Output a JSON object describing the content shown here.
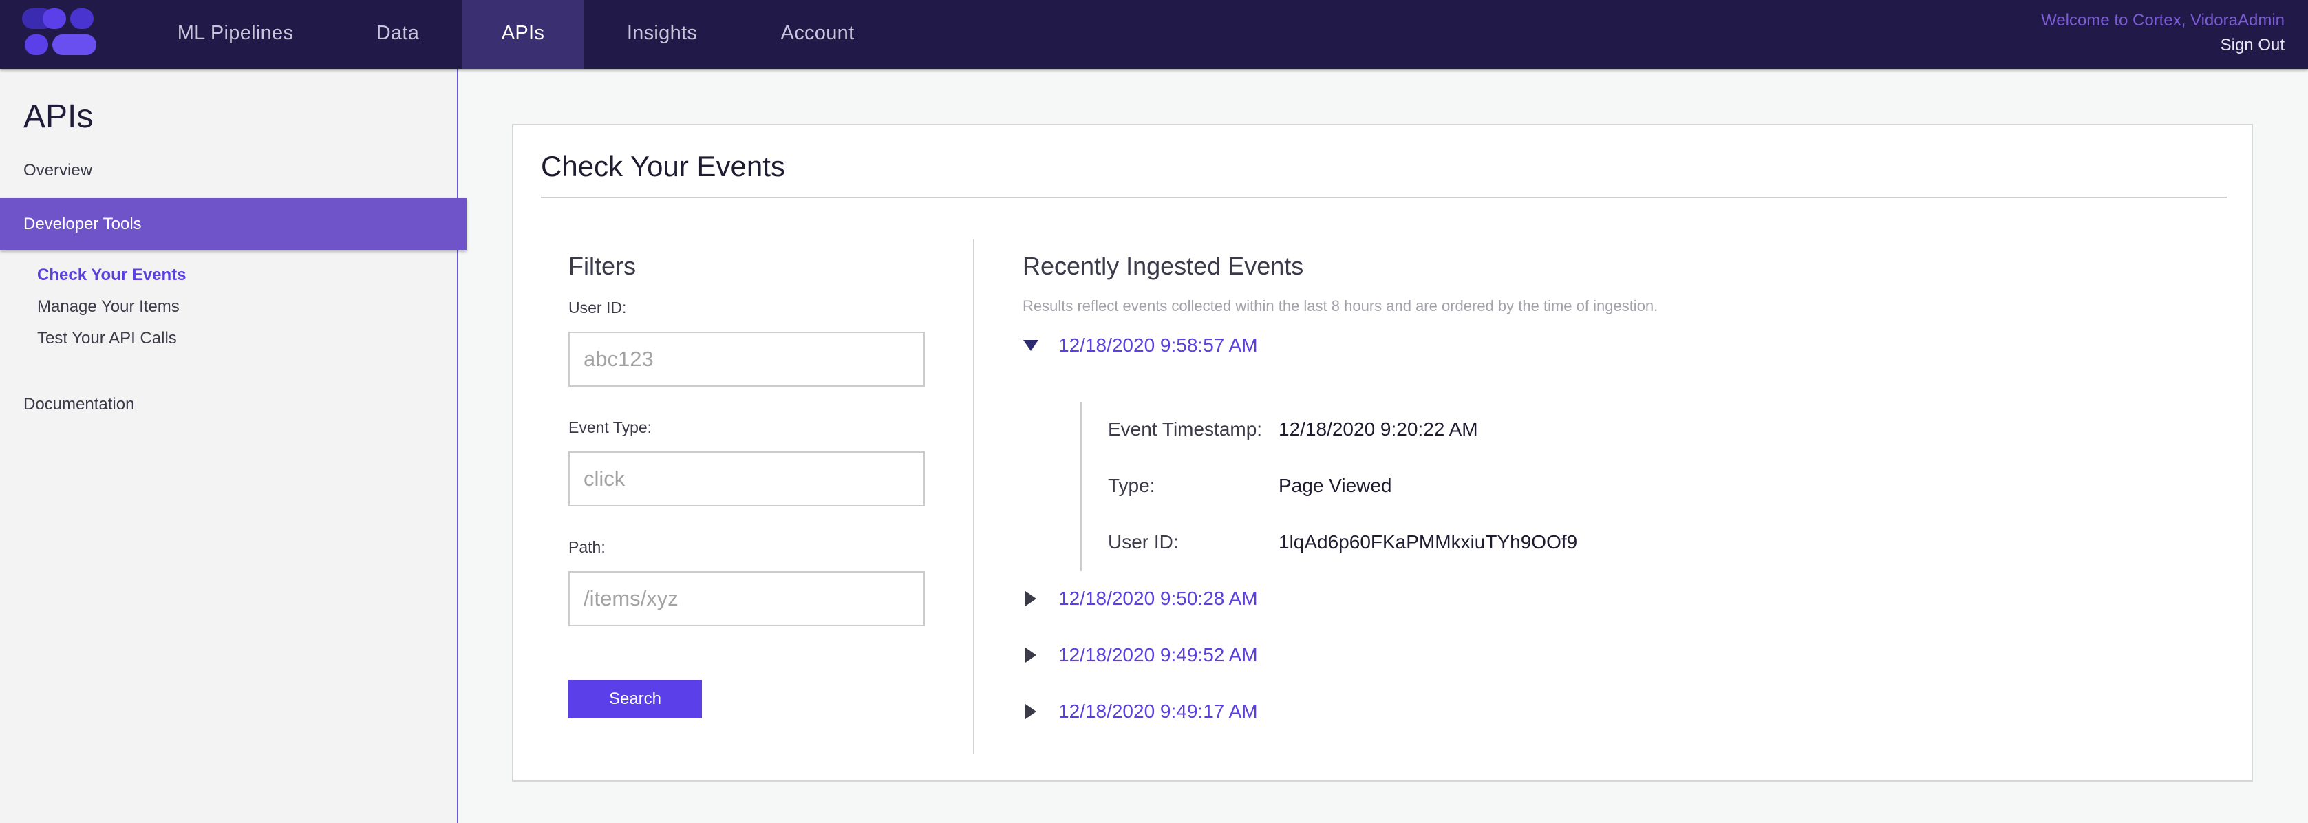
{
  "nav": {
    "logo_icon": "cortex-logo-icon",
    "items": [
      {
        "label": "ML Pipelines",
        "active": false
      },
      {
        "label": "Data",
        "active": false
      },
      {
        "label": "APIs",
        "active": true
      },
      {
        "label": "Insights",
        "active": false
      },
      {
        "label": "Account",
        "active": false
      }
    ],
    "welcome": "Welcome to Cortex, VidoraAdmin",
    "sign_out": "Sign Out"
  },
  "sidebar": {
    "title": "APIs",
    "overview": "Overview",
    "developer_tools": "Developer Tools",
    "sub_items": [
      {
        "label": "Check Your Events",
        "current": true
      },
      {
        "label": "Manage Your Items",
        "current": false
      },
      {
        "label": "Test Your API Calls",
        "current": false
      }
    ],
    "documentation": "Documentation"
  },
  "main": {
    "title": "Check Your Events",
    "filters": {
      "title": "Filters",
      "user_id_label": "User ID:",
      "user_id_placeholder": "abc123",
      "user_id_value": "",
      "event_type_label": "Event Type:",
      "event_type_placeholder": "click",
      "event_type_value": "",
      "path_label": "Path:",
      "path_placeholder": "/items/xyz",
      "path_value": "",
      "search_label": "Search"
    },
    "events": {
      "title": "Recently Ingested Events",
      "note": "Results reflect events collected within the last 8 hours and are ordered by the time of ingestion.",
      "list": [
        {
          "timestamp": "12/18/2020 9:58:57 AM",
          "expanded": true,
          "icon": "caret-down-icon"
        },
        {
          "timestamp": "12/18/2020 9:50:28 AM",
          "expanded": false,
          "icon": "caret-right-icon"
        },
        {
          "timestamp": "12/18/2020 9:49:52 AM",
          "expanded": false,
          "icon": "caret-right-icon"
        },
        {
          "timestamp": "12/18/2020 9:49:17 AM",
          "expanded": false,
          "icon": "caret-right-icon"
        }
      ],
      "detail": {
        "event_timestamp_label": "Event Timestamp:",
        "event_timestamp_value": "12/18/2020 9:20:22 AM",
        "type_label": "Type:",
        "type_value": "Page Viewed",
        "user_id_label": "User ID:",
        "user_id_value": "1lqAd6p60FKaPMMkxiuTYh9OOf9"
      }
    }
  },
  "colors": {
    "topbar": "#211a48",
    "accent": "#5b3fe0",
    "sidebar_active": "#6e54c8",
    "button": "#5b3fe8"
  }
}
